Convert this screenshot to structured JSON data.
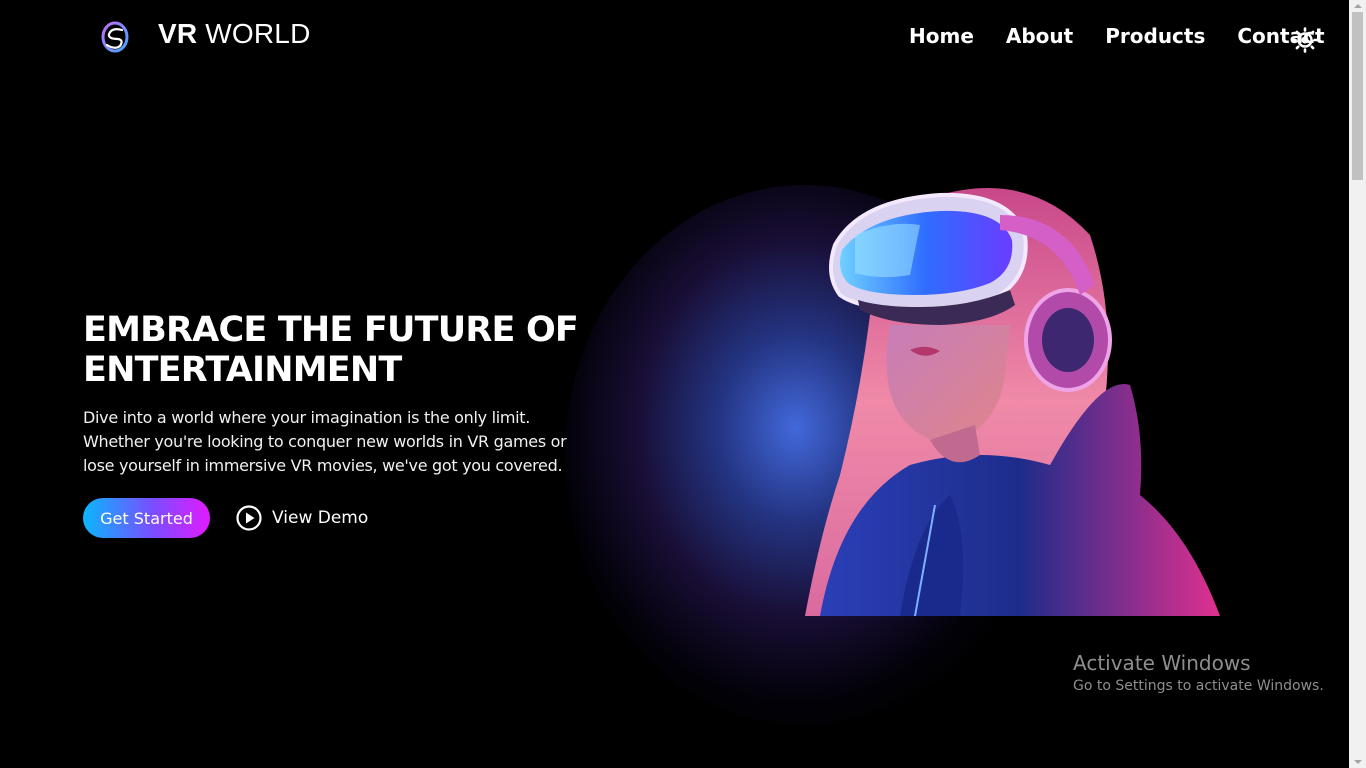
{
  "header": {
    "brand_bold": "VR",
    "brand_rest": "WORLD",
    "logo_icon": "vr-logo-icon",
    "nav": [
      "Home",
      "About",
      "Products",
      "Contact"
    ],
    "theme_icon": "sun-icon"
  },
  "hero": {
    "title": "EMBRACE THE FUTURE OF ENTERTAINMENT",
    "description": "Dive into a world where your imagination is the only limit. Whether you're looking to conquer new worlds in VR games or lose yourself in immersive VR movies, we've got you covered.",
    "primary_button": "Get Started",
    "secondary_button": "View Demo",
    "secondary_icon": "play-circle-icon",
    "image": "vr-headset-woman-image"
  },
  "watermark": {
    "title": "Activate Windows",
    "subtitle": "Go to Settings to activate Windows."
  },
  "colors": {
    "background": "#000000",
    "gradient_start": "#0bb6ff",
    "gradient_end": "#e11bff",
    "glow": "#4a6ee6"
  }
}
